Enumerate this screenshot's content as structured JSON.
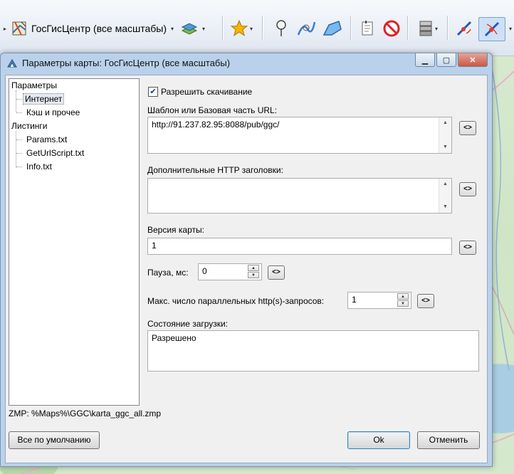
{
  "toolbar": {
    "map_selector_label": "ГосГисЦентр (все масштабы)"
  },
  "dialog": {
    "title": "Параметры карты: ГосГисЦентр (все масштабы)",
    "tree": {
      "root_params": "Параметры",
      "internet": "Интернет",
      "cache": "Кэш и прочее",
      "root_listings": "Листинги",
      "params_txt": "Params.txt",
      "geturl_txt": "GetUrlScript.txt",
      "info_txt": "Info.txt"
    },
    "allow_download": {
      "label": "Разрешить скачивание",
      "checked": true
    },
    "url_template": {
      "label": "Шаблон или Базовая часть URL:",
      "value": "http://91.237.82.95:8088/pub/ggc/"
    },
    "http_headers": {
      "label": "Дополнительные HTTP заголовки:",
      "value": ""
    },
    "map_version": {
      "label": "Версия карты:",
      "value": "1"
    },
    "pause": {
      "label": "Пауза, мс:",
      "value": "0"
    },
    "max_requests": {
      "label": "Макс. число параллельных http(s)-запросов:",
      "value": "1"
    },
    "load_state": {
      "label": "Состояние загрузки:",
      "value": "Разрешено"
    },
    "reset_button": "<>",
    "zmp_path": "ZMP:  %Maps%\\GGC\\karta_ggc_all.zmp",
    "defaults_button": "Все по умолчанию",
    "ok_button": "Ok",
    "cancel_button": "Отменить"
  }
}
